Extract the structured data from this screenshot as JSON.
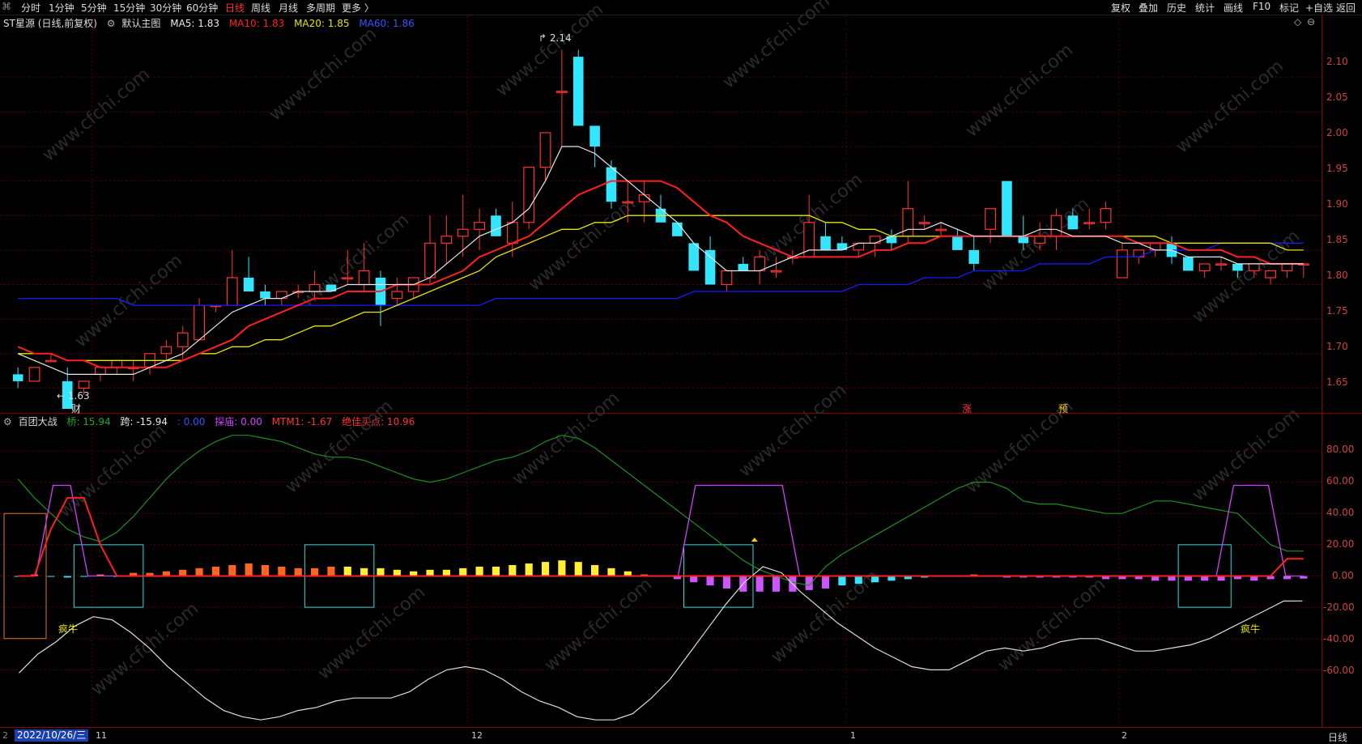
{
  "topbar": {
    "periods": [
      "分时",
      "1分钟",
      "5分钟",
      "15分钟",
      "30分钟",
      "60分钟",
      "日线",
      "周线",
      "月线",
      "多周期",
      "更多 〉"
    ],
    "active": "日线",
    "tools": [
      "复权",
      "叠加",
      "历史",
      "统计",
      "画线",
      "F10",
      "标记",
      "+自选",
      "返回"
    ]
  },
  "main": {
    "title": "ST星源 (日线,前复权)",
    "template": "默认主图",
    "ma5": "MA5: 1.83",
    "ma10": "MA10: 1.83",
    "ma20": "MA20: 1.85",
    "ma60": "MA60: 1.86",
    "high_label": "2.14",
    "low_label": "1.63",
    "marker_cai": "财",
    "marker_zhang": "涨",
    "marker_yu": "预",
    "price_ticks": [
      "2.10",
      "2.05",
      "2.00",
      "1.95",
      "1.90",
      "1.85",
      "1.80",
      "1.75",
      "1.70",
      "1.65"
    ]
  },
  "indicator": {
    "name": "百团大战",
    "qiao": "桥: 15.94",
    "kua": "跨: -15.94",
    "zero": ": 0.00",
    "tanlu": "探庙: 0.00",
    "mtm": "MTM1: -1.67",
    "buy": "绝佳买点: 10.96",
    "label_fengniu_1": "疯牛",
    "label_fengniu_2": "疯牛",
    "ticks": [
      "80.00",
      "60.00",
      "40.00",
      "20.00",
      "0.00",
      "-20.00",
      "-40.00",
      "-60.00"
    ]
  },
  "xaxis": {
    "date": "2022/10/26/三",
    "labels": [
      "11",
      "12",
      "1",
      "2"
    ],
    "period": "日线"
  },
  "watermark": "www.cfchi.com",
  "colors": {
    "up": "#ff3333",
    "down": "#33e6ff",
    "ma5": "#e8e8e8",
    "ma10": "#ff2020",
    "ma20": "#e6e600",
    "ma60": "#1a1aff"
  },
  "chart_data": [
    {
      "type": "candlestick",
      "title": "ST星源 (日线,前复权)",
      "ylim": [
        1.62,
        2.17
      ],
      "candles": [
        [
          1.67,
          1.68,
          1.65,
          1.66
        ],
        [
          1.66,
          1.68,
          1.66,
          1.68
        ],
        [
          1.69,
          1.7,
          1.69,
          1.69
        ],
        [
          1.66,
          1.68,
          1.64,
          1.62
        ],
        [
          1.65,
          1.66,
          1.64,
          1.66
        ],
        [
          1.67,
          1.68,
          1.66,
          1.68
        ],
        [
          1.68,
          1.69,
          1.67,
          1.69
        ],
        [
          1.68,
          1.69,
          1.66,
          1.68
        ],
        [
          1.68,
          1.7,
          1.67,
          1.7
        ],
        [
          1.7,
          1.72,
          1.69,
          1.71
        ],
        [
          1.71,
          1.74,
          1.69,
          1.73
        ],
        [
          1.72,
          1.78,
          1.72,
          1.77
        ],
        [
          1.77,
          1.77,
          1.76,
          1.77
        ],
        [
          1.77,
          1.85,
          1.77,
          1.81
        ],
        [
          1.81,
          1.84,
          1.79,
          1.79
        ],
        [
          1.79,
          1.8,
          1.77,
          1.78
        ],
        [
          1.78,
          1.79,
          1.77,
          1.79
        ],
        [
          1.79,
          1.8,
          1.78,
          1.79
        ],
        [
          1.79,
          1.82,
          1.78,
          1.8
        ],
        [
          1.8,
          1.8,
          1.79,
          1.79
        ],
        [
          1.81,
          1.85,
          1.8,
          1.81
        ],
        [
          1.8,
          1.86,
          1.79,
          1.82
        ],
        [
          1.81,
          1.82,
          1.74,
          1.77
        ],
        [
          1.78,
          1.81,
          1.77,
          1.79
        ],
        [
          1.79,
          1.81,
          1.78,
          1.81
        ],
        [
          1.81,
          1.9,
          1.8,
          1.86
        ],
        [
          1.86,
          1.9,
          1.83,
          1.87
        ],
        [
          1.87,
          1.93,
          1.84,
          1.88
        ],
        [
          1.88,
          1.91,
          1.85,
          1.89
        ],
        [
          1.9,
          1.91,
          1.88,
          1.87
        ],
        [
          1.86,
          1.92,
          1.84,
          1.89
        ],
        [
          1.89,
          1.97,
          1.88,
          1.97
        ],
        [
          1.97,
          2.02,
          1.95,
          2.02
        ],
        [
          2.08,
          2.14,
          2.0,
          2.08
        ],
        [
          2.13,
          2.14,
          2.03,
          2.03
        ],
        [
          2.03,
          2.02,
          1.97,
          2.0
        ],
        [
          1.97,
          1.98,
          1.91,
          1.92
        ],
        [
          1.92,
          1.95,
          1.89,
          1.92
        ],
        [
          1.92,
          1.95,
          1.89,
          1.93
        ],
        [
          1.91,
          1.93,
          1.9,
          1.89
        ],
        [
          1.89,
          1.89,
          1.87,
          1.87
        ],
        [
          1.86,
          1.86,
          1.84,
          1.82
        ],
        [
          1.85,
          1.87,
          1.8,
          1.8
        ],
        [
          1.8,
          1.8,
          1.79,
          1.82
        ],
        [
          1.83,
          1.84,
          1.82,
          1.82
        ],
        [
          1.82,
          1.85,
          1.8,
          1.84
        ],
        [
          1.82,
          1.84,
          1.81,
          1.82
        ],
        [
          1.84,
          1.85,
          1.83,
          1.84
        ],
        [
          1.84,
          1.93,
          1.84,
          1.89
        ],
        [
          1.87,
          1.89,
          1.86,
          1.85
        ],
        [
          1.86,
          1.87,
          1.85,
          1.85
        ],
        [
          1.85,
          1.86,
          1.84,
          1.86
        ],
        [
          1.86,
          1.87,
          1.84,
          1.87
        ],
        [
          1.87,
          1.88,
          1.85,
          1.86
        ],
        [
          1.87,
          1.95,
          1.86,
          1.91
        ],
        [
          1.89,
          1.9,
          1.88,
          1.89
        ],
        [
          1.88,
          1.89,
          1.87,
          1.88
        ],
        [
          1.87,
          1.88,
          1.86,
          1.85
        ],
        [
          1.85,
          1.87,
          1.82,
          1.83
        ],
        [
          1.88,
          1.9,
          1.86,
          1.91
        ],
        [
          1.95,
          1.95,
          1.87,
          1.87
        ],
        [
          1.87,
          1.9,
          1.85,
          1.86
        ],
        [
          1.86,
          1.89,
          1.85,
          1.87
        ],
        [
          1.87,
          1.91,
          1.85,
          1.9
        ],
        [
          1.9,
          1.91,
          1.88,
          1.88
        ],
        [
          1.89,
          1.91,
          1.88,
          1.89
        ],
        [
          1.89,
          1.92,
          1.88,
          1.91
        ],
        [
          1.81,
          1.86,
          1.81,
          1.85
        ],
        [
          1.84,
          1.85,
          1.83,
          1.85
        ],
        [
          1.85,
          1.86,
          1.84,
          1.86
        ],
        [
          1.86,
          1.87,
          1.83,
          1.84
        ],
        [
          1.84,
          1.84,
          1.82,
          1.82
        ],
        [
          1.82,
          1.83,
          1.81,
          1.83
        ],
        [
          1.83,
          1.84,
          1.82,
          1.83
        ],
        [
          1.83,
          1.83,
          1.81,
          1.82
        ],
        [
          1.82,
          1.83,
          1.81,
          1.83
        ],
        [
          1.81,
          1.82,
          1.8,
          1.82
        ],
        [
          1.82,
          1.83,
          1.81,
          1.83
        ],
        [
          1.83,
          1.83,
          1.81,
          1.83
        ]
      ],
      "ma5": [
        1.7,
        1.69,
        1.68,
        1.67,
        1.67,
        1.67,
        1.67,
        1.67,
        1.68,
        1.69,
        1.7,
        1.72,
        1.74,
        1.76,
        1.77,
        1.78,
        1.78,
        1.79,
        1.79,
        1.79,
        1.8,
        1.8,
        1.8,
        1.8,
        1.8,
        1.81,
        1.83,
        1.85,
        1.87,
        1.88,
        1.89,
        1.91,
        1.95,
        2.0,
        2.0,
        1.99,
        1.97,
        1.95,
        1.93,
        1.91,
        1.89,
        1.86,
        1.84,
        1.82,
        1.82,
        1.82,
        1.83,
        1.84,
        1.85,
        1.85,
        1.85,
        1.86,
        1.86,
        1.87,
        1.88,
        1.88,
        1.89,
        1.88,
        1.87,
        1.87,
        1.87,
        1.87,
        1.88,
        1.88,
        1.87,
        1.87,
        1.87,
        1.86,
        1.86,
        1.85,
        1.85,
        1.84,
        1.84,
        1.84,
        1.83,
        1.83,
        1.83,
        1.83,
        1.83
      ],
      "ma10": [
        1.71,
        1.7,
        1.7,
        1.69,
        1.69,
        1.68,
        1.68,
        1.68,
        1.68,
        1.68,
        1.69,
        1.7,
        1.71,
        1.72,
        1.74,
        1.75,
        1.76,
        1.77,
        1.78,
        1.78,
        1.79,
        1.79,
        1.79,
        1.8,
        1.8,
        1.8,
        1.81,
        1.82,
        1.84,
        1.85,
        1.86,
        1.87,
        1.89,
        1.91,
        1.93,
        1.94,
        1.95,
        1.95,
        1.95,
        1.95,
        1.94,
        1.92,
        1.9,
        1.89,
        1.87,
        1.86,
        1.85,
        1.84,
        1.84,
        1.84,
        1.84,
        1.84,
        1.85,
        1.85,
        1.86,
        1.86,
        1.87,
        1.87,
        1.87,
        1.87,
        1.87,
        1.87,
        1.87,
        1.87,
        1.87,
        1.87,
        1.87,
        1.87,
        1.86,
        1.86,
        1.86,
        1.85,
        1.85,
        1.85,
        1.84,
        1.84,
        1.83,
        1.83,
        1.83
      ],
      "ma20": [
        1.7,
        1.7,
        1.7,
        1.69,
        1.69,
        1.69,
        1.69,
        1.69,
        1.69,
        1.69,
        1.69,
        1.7,
        1.7,
        1.71,
        1.71,
        1.72,
        1.72,
        1.73,
        1.74,
        1.74,
        1.75,
        1.76,
        1.76,
        1.77,
        1.78,
        1.79,
        1.8,
        1.81,
        1.82,
        1.84,
        1.85,
        1.86,
        1.87,
        1.88,
        1.88,
        1.89,
        1.89,
        1.9,
        1.9,
        1.9,
        1.9,
        1.9,
        1.9,
        1.9,
        1.9,
        1.9,
        1.9,
        1.9,
        1.9,
        1.89,
        1.89,
        1.88,
        1.88,
        1.87,
        1.87,
        1.87,
        1.87,
        1.87,
        1.87,
        1.87,
        1.87,
        1.87,
        1.87,
        1.87,
        1.87,
        1.87,
        1.87,
        1.87,
        1.87,
        1.87,
        1.86,
        1.86,
        1.86,
        1.86,
        1.86,
        1.86,
        1.86,
        1.85,
        1.85
      ],
      "ma60": [
        1.78,
        1.78,
        1.78,
        1.78,
        1.78,
        1.78,
        1.78,
        1.77,
        1.77,
        1.77,
        1.77,
        1.77,
        1.77,
        1.77,
        1.77,
        1.77,
        1.77,
        1.77,
        1.77,
        1.77,
        1.77,
        1.77,
        1.77,
        1.77,
        1.77,
        1.77,
        1.77,
        1.77,
        1.77,
        1.78,
        1.78,
        1.78,
        1.78,
        1.78,
        1.78,
        1.78,
        1.78,
        1.78,
        1.78,
        1.78,
        1.78,
        1.79,
        1.79,
        1.79,
        1.79,
        1.79,
        1.79,
        1.79,
        1.79,
        1.79,
        1.79,
        1.8,
        1.8,
        1.8,
        1.8,
        1.81,
        1.81,
        1.81,
        1.82,
        1.82,
        1.82,
        1.82,
        1.83,
        1.83,
        1.83,
        1.83,
        1.84,
        1.84,
        1.84,
        1.85,
        1.85,
        1.85,
        1.85,
        1.86,
        1.86,
        1.86,
        1.86,
        1.86,
        1.86
      ]
    },
    {
      "type": "line",
      "title": "百团大战",
      "ylim": [
        -95,
        95
      ],
      "green": [
        62,
        50,
        40,
        30,
        25,
        22,
        28,
        38,
        50,
        62,
        72,
        80,
        86,
        90,
        90,
        88,
        86,
        82,
        78,
        76,
        76,
        74,
        70,
        66,
        62,
        60,
        62,
        66,
        70,
        74,
        76,
        80,
        86,
        90,
        88,
        82,
        74,
        66,
        58,
        50,
        42,
        34,
        26,
        18,
        10,
        4,
        0,
        -4,
        -6,
        6,
        14,
        20,
        26,
        32,
        38,
        44,
        50,
        56,
        60,
        60,
        56,
        48,
        46,
        46,
        44,
        42,
        40,
        40,
        44,
        48,
        48,
        46,
        44,
        42,
        40,
        30,
        20,
        16,
        15.94
      ],
      "white": [
        -62,
        -50,
        -42,
        -32,
        -26,
        -28,
        -36,
        -46,
        -58,
        -68,
        -78,
        -86,
        -90,
        -92,
        -90,
        -86,
        -84,
        -80,
        -78,
        -78,
        -78,
        -74,
        -66,
        -60,
        -58,
        -60,
        -66,
        -74,
        -80,
        -84,
        -90,
        -92,
        -92,
        -88,
        -78,
        -66,
        -50,
        -34,
        -18,
        -4,
        6,
        2,
        -10,
        -20,
        -30,
        -38,
        -46,
        -52,
        -58,
        -60,
        -60,
        -54,
        -48,
        -46,
        -48,
        -46,
        -42,
        -40,
        -40,
        -44,
        -48,
        -48,
        -46,
        -44,
        -40,
        -34,
        -28,
        -22,
        -16,
        -15.94
      ],
      "magenta": [
        0,
        0,
        58,
        58,
        0,
        0,
        0,
        0,
        0,
        0,
        0,
        0,
        0,
        0,
        0,
        0,
        0,
        0,
        0,
        0,
        0,
        0,
        0,
        0,
        0,
        0,
        0,
        0,
        0,
        0,
        0,
        0,
        0,
        0,
        0,
        0,
        0,
        0,
        0,
        58,
        58,
        58,
        58,
        58,
        58,
        0,
        0,
        0,
        0,
        0,
        0,
        0,
        0,
        0,
        0,
        0,
        0,
        0,
        0,
        0,
        0,
        0,
        0,
        0,
        0,
        0,
        0,
        0,
        0,
        0,
        58,
        58,
        58,
        0,
        0
      ],
      "red": [
        0,
        0,
        30,
        50,
        50,
        20,
        0,
        0,
        0,
        0,
        0,
        0,
        0,
        0,
        0,
        0,
        0,
        0,
        0,
        0,
        0,
        0,
        0,
        0,
        0,
        0,
        0,
        0,
        0,
        0,
        0,
        0,
        0,
        0,
        0,
        0,
        0,
        0,
        0,
        0,
        0,
        0,
        0,
        0,
        0,
        0,
        0,
        0,
        0,
        0,
        0,
        0,
        0,
        0,
        0,
        0,
        0,
        0,
        0,
        0,
        0,
        0,
        0,
        0,
        0,
        0,
        0,
        0,
        0,
        0,
        0,
        0,
        0,
        0,
        0,
        0,
        0,
        10.96,
        10.96
      ],
      "bars": [
        0,
        1,
        0,
        -1,
        0,
        1,
        0,
        2,
        2,
        3,
        4,
        5,
        6,
        7,
        8,
        7,
        6,
        5,
        5,
        6,
        6,
        5,
        5,
        4,
        3,
        4,
        4,
        5,
        6,
        6,
        7,
        8,
        9,
        10,
        9,
        7,
        5,
        3,
        1,
        0,
        -2,
        -4,
        -6,
        -8,
        -10,
        -10,
        -10,
        -10,
        -9,
        -8,
        -6,
        -5,
        -4,
        -3,
        -2,
        -1,
        0,
        0,
        1,
        0,
        -1,
        -1,
        -1,
        -1,
        -1,
        -1,
        -2,
        -2,
        -2,
        -3,
        -3,
        -3,
        -3,
        -3,
        -2,
        -3,
        -2,
        -2,
        -1.67
      ]
    }
  ]
}
